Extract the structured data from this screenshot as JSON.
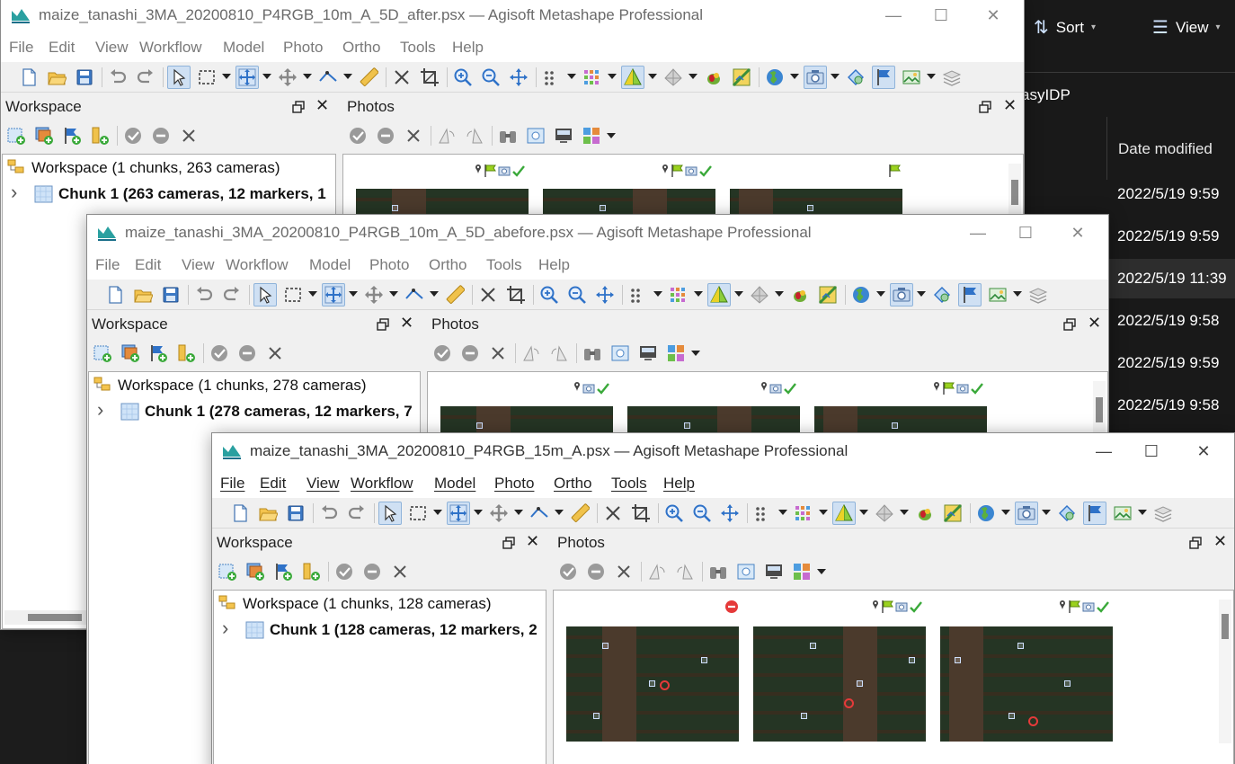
{
  "explorer": {
    "toolbar": {
      "sort_label": "Sort",
      "view_label": "View"
    },
    "path_fragment": "asyIDP",
    "column_header": "Date modified",
    "rows": [
      {
        "date": "2022/5/19 9:59",
        "selected": false
      },
      {
        "date": "2022/5/19 9:59",
        "selected": false
      },
      {
        "date": "2022/5/19 11:39",
        "selected": true
      },
      {
        "date": "2022/5/19 9:58",
        "selected": false
      },
      {
        "date": "2022/5/19 9:59",
        "selected": false
      },
      {
        "date": "2022/5/19 9:58",
        "selected": false
      }
    ]
  },
  "menu": [
    "File",
    "Edit",
    "View",
    "Workflow",
    "Model",
    "Photo",
    "Ortho",
    "Tools",
    "Help"
  ],
  "panes": {
    "workspace_title": "Workspace",
    "photos_title": "Photos"
  },
  "windows": [
    {
      "title": "maize_tanashi_3MA_20200810_P4RGB_10m_A_5D_after.psx — Agisoft Metashape Professional",
      "workspace_label": "Workspace (1 chunks, 263 cameras)",
      "chunk_label": "Chunk 1 (263 cameras, 12 markers, 1",
      "state": "inactive"
    },
    {
      "title": "maize_tanashi_3MA_20200810_P4RGB_10m_A_5D_abefore.psx — Agisoft Metashape Professional",
      "workspace_label": "Workspace (1 chunks, 278 cameras)",
      "chunk_label": "Chunk 1 (278 cameras, 12 markers, 7",
      "state": "inactive"
    },
    {
      "title": "maize_tanashi_3MA_20200810_P4RGB_15m_A.psx — Agisoft Metashape Professional",
      "workspace_label": "Workspace (1 chunks, 128 cameras)",
      "chunk_label": "Chunk 1 (128 cameras, 12 markers, 2",
      "state": "active"
    }
  ],
  "colors": {
    "explorer_bg": "#191919",
    "window_bg": "#f0f0f0",
    "pressed_button": "#cfe0f3",
    "accent_blue": "#2f72c8",
    "marker_flag": "#9bd21f",
    "check_green": "#3aa93a",
    "error_red": "#e53a3a"
  }
}
